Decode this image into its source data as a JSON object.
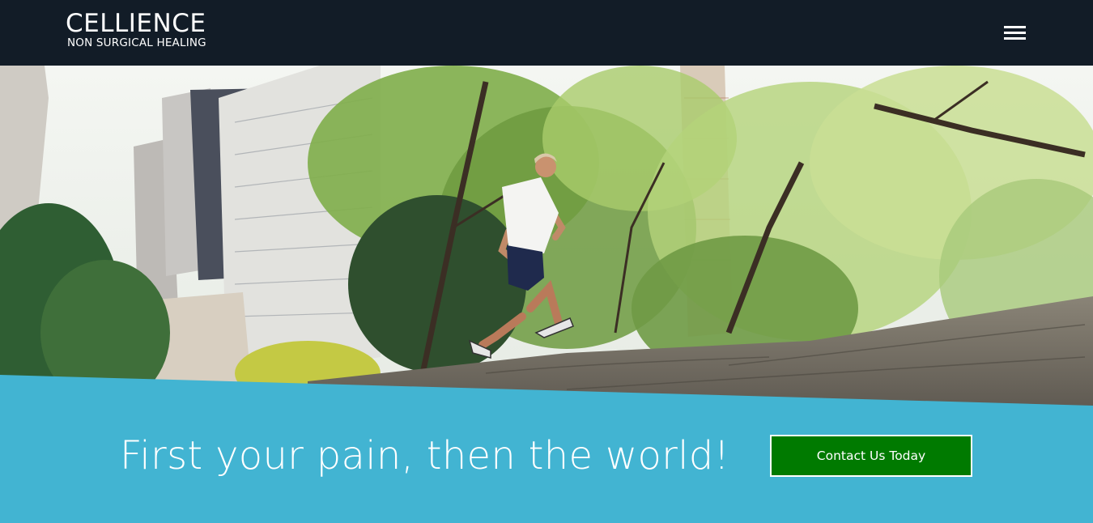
{
  "header": {
    "brand_name": "CELLIENCE",
    "brand_tagline": "NON SURGICAL HEALING",
    "menu_icon": "hamburger-menu-icon",
    "background_color": "#121c27"
  },
  "hero": {
    "image": "man-running-in-park-photo"
  },
  "banner": {
    "headline": "First your pain, then the world!",
    "cta_label": "Contact Us Today",
    "cta_color": "#007a00",
    "background_color": "#42b4d2"
  }
}
